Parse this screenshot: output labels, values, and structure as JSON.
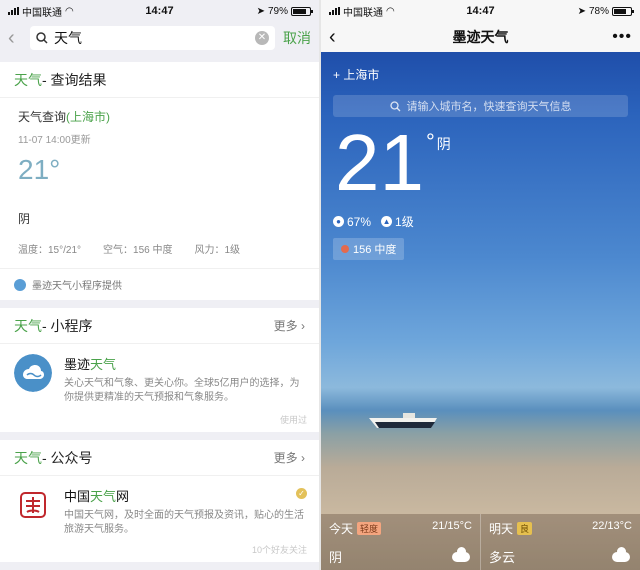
{
  "status_left": {
    "carrier": "中国联通",
    "time": "14:47",
    "battery": "79%",
    "battery_level": 0.79
  },
  "status_right": {
    "carrier": "中国联通",
    "time": "14:47",
    "battery": "78%",
    "battery_level": 0.78
  },
  "search": {
    "query": "天气",
    "cancel": "取消"
  },
  "results": {
    "header_kw": "天气",
    "header_rest": " - 查询结果",
    "query_label": "天气查询",
    "city": "上海市",
    "updated": "11-07  14:00更新",
    "temp": "21°",
    "condition": "阴",
    "humidity": "温度：15°/21°",
    "air": "空气：156 中度",
    "wind": "风力：1级",
    "provider": "墨迹天气小程序提供"
  },
  "mini_programs": {
    "header_kw": "天气",
    "header_rest": " - 小程序",
    "more": "更多",
    "item": {
      "name_a": "墨迹",
      "name_b": "天气",
      "desc": "关心天气和气象、更关心你。全球5亿用户的选择，为你提供更精准的天气预报和气象服务。",
      "used": "使用过"
    }
  },
  "official_accounts": {
    "header_kw": "天气",
    "header_rest": " - 公众号",
    "more": "更多",
    "item": {
      "name_a": "中国",
      "name_b": "天气",
      "name_c": "网",
      "desc": "中国天气网，及时全面的天气预报及资讯，贴心的生活旅游天气服务。",
      "followers": "10个好友关注",
      "verified": "✓"
    }
  },
  "weather": {
    "title": "墨迹天气",
    "city": "上海市",
    "search_placeholder": "请输入城市名，快速查询天气信息",
    "temp": "21",
    "deg": "°",
    "condition": "阴",
    "humidity": "67%",
    "wind": "1级",
    "aqi": "156 中度",
    "today": {
      "label": "今天",
      "badge": "轻度",
      "range": "21/15°C",
      "cond": "阴"
    },
    "tomorrow": {
      "label": "明天",
      "badge": "良",
      "range": "22/13°C",
      "cond": "多云"
    }
  }
}
